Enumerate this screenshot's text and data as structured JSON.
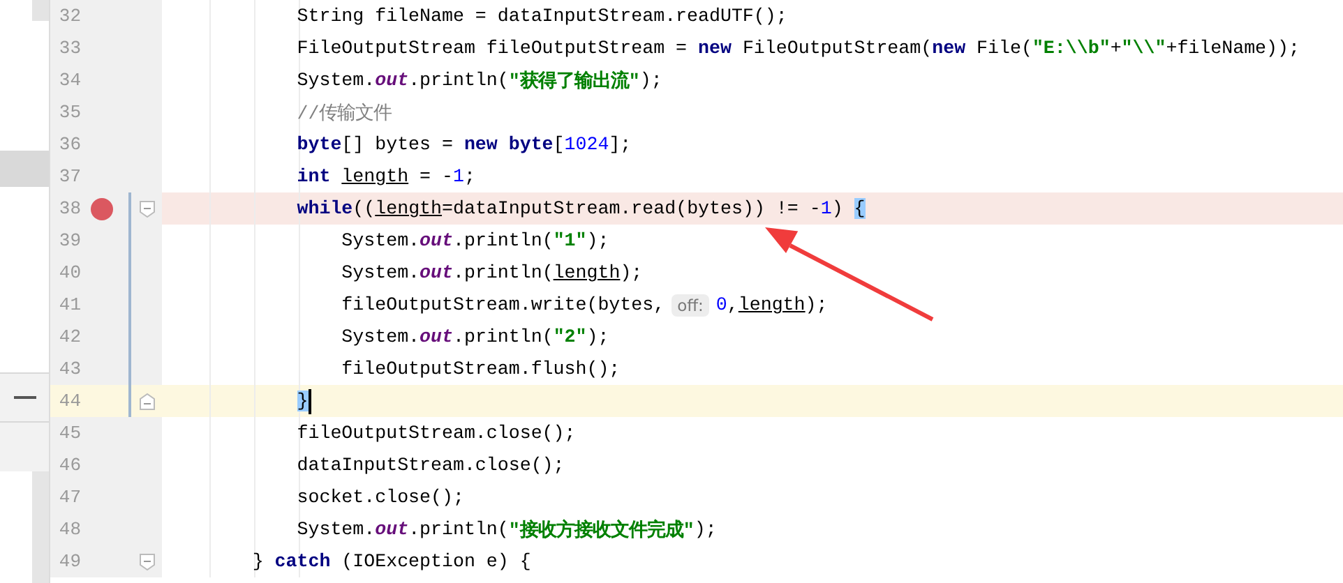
{
  "editor": {
    "lines": [
      {
        "number": "32",
        "breakpoint": false,
        "current": false,
        "fold_start": false,
        "fold_end": false,
        "scope": false,
        "tokens": [
          {
            "kind": "plain",
            "text": "            String fileName = dataInputStream.readUTF();"
          }
        ]
      },
      {
        "number": "33",
        "breakpoint": false,
        "current": false,
        "fold_start": false,
        "fold_end": false,
        "scope": false,
        "tokens": [
          {
            "kind": "plain",
            "text": "            FileOutputStream fileOutputStream = "
          },
          {
            "kind": "keyword",
            "text": "new"
          },
          {
            "kind": "plain",
            "text": " FileOutputStream("
          },
          {
            "kind": "keyword",
            "text": "new"
          },
          {
            "kind": "plain",
            "text": " File("
          },
          {
            "kind": "string",
            "text": "\"E:\\\\b\""
          },
          {
            "kind": "plain",
            "text": "+"
          },
          {
            "kind": "string",
            "text": "\"\\\\\""
          },
          {
            "kind": "plain",
            "text": "+fileName));"
          }
        ]
      },
      {
        "number": "34",
        "breakpoint": false,
        "current": false,
        "fold_start": false,
        "fold_end": false,
        "scope": false,
        "tokens": [
          {
            "kind": "plain",
            "text": "            System."
          },
          {
            "kind": "static",
            "text": "out"
          },
          {
            "kind": "plain",
            "text": ".println("
          },
          {
            "kind": "string",
            "text": "\"获得了输出流\""
          },
          {
            "kind": "plain",
            "text": ");"
          }
        ]
      },
      {
        "number": "35",
        "breakpoint": false,
        "current": false,
        "fold_start": false,
        "fold_end": false,
        "scope": false,
        "tokens": [
          {
            "kind": "comment",
            "text": "            //传输文件"
          }
        ]
      },
      {
        "number": "36",
        "breakpoint": false,
        "current": false,
        "fold_start": false,
        "fold_end": false,
        "scope": false,
        "tokens": [
          {
            "kind": "keyword",
            "text": "            byte"
          },
          {
            "kind": "plain",
            "text": "[] bytes = "
          },
          {
            "kind": "keyword",
            "text": "new byte"
          },
          {
            "kind": "plain",
            "text": "["
          },
          {
            "kind": "number",
            "text": "1024"
          },
          {
            "kind": "plain",
            "text": "];"
          }
        ]
      },
      {
        "number": "37",
        "breakpoint": false,
        "current": false,
        "fold_start": false,
        "fold_end": false,
        "scope": false,
        "tokens": [
          {
            "kind": "keyword",
            "text": "            int "
          },
          {
            "kind": "variable",
            "text": "length"
          },
          {
            "kind": "plain",
            "text": " = -"
          },
          {
            "kind": "number",
            "text": "1"
          },
          {
            "kind": "plain",
            "text": ";"
          }
        ]
      },
      {
        "number": "38",
        "breakpoint": true,
        "current": false,
        "fold_start": true,
        "fold_end": false,
        "scope": true,
        "tokens": [
          {
            "kind": "keyword",
            "text": "            while"
          },
          {
            "kind": "plain",
            "text": "(("
          },
          {
            "kind": "variable",
            "text": "length"
          },
          {
            "kind": "plain",
            "text": "=dataInputStream.read(bytes)) != -"
          },
          {
            "kind": "number",
            "text": "1"
          },
          {
            "kind": "plain",
            "text": ") "
          },
          {
            "kind": "brace_match",
            "text": "{"
          }
        ]
      },
      {
        "number": "39",
        "breakpoint": false,
        "current": false,
        "fold_start": false,
        "fold_end": false,
        "scope": true,
        "tokens": [
          {
            "kind": "plain",
            "text": "                System."
          },
          {
            "kind": "static",
            "text": "out"
          },
          {
            "kind": "plain",
            "text": ".println("
          },
          {
            "kind": "string",
            "text": "\"1\""
          },
          {
            "kind": "plain",
            "text": ");"
          }
        ]
      },
      {
        "number": "40",
        "breakpoint": false,
        "current": false,
        "fold_start": false,
        "fold_end": false,
        "scope": true,
        "tokens": [
          {
            "kind": "plain",
            "text": "                System."
          },
          {
            "kind": "static",
            "text": "out"
          },
          {
            "kind": "plain",
            "text": ".println("
          },
          {
            "kind": "variable",
            "text": "length"
          },
          {
            "kind": "plain",
            "text": ");"
          }
        ]
      },
      {
        "number": "41",
        "breakpoint": false,
        "current": false,
        "fold_start": false,
        "fold_end": false,
        "scope": true,
        "tokens": [
          {
            "kind": "plain",
            "text": "                fileOutputStream.write(bytes,"
          },
          {
            "kind": "hint",
            "text": "off:"
          },
          {
            "kind": "number",
            "text": "0"
          },
          {
            "kind": "plain",
            "text": ","
          },
          {
            "kind": "variable",
            "text": "length"
          },
          {
            "kind": "plain",
            "text": ");"
          }
        ]
      },
      {
        "number": "42",
        "breakpoint": false,
        "current": false,
        "fold_start": false,
        "fold_end": false,
        "scope": true,
        "tokens": [
          {
            "kind": "plain",
            "text": "                System."
          },
          {
            "kind": "static",
            "text": "out"
          },
          {
            "kind": "plain",
            "text": ".println("
          },
          {
            "kind": "string",
            "text": "\"2\""
          },
          {
            "kind": "plain",
            "text": ");"
          }
        ]
      },
      {
        "number": "43",
        "breakpoint": false,
        "current": false,
        "fold_start": false,
        "fold_end": false,
        "scope": true,
        "tokens": [
          {
            "kind": "plain",
            "text": "                fileOutputStream.flush();"
          }
        ]
      },
      {
        "number": "44",
        "breakpoint": false,
        "current": true,
        "fold_start": false,
        "fold_end": true,
        "scope": true,
        "tokens": [
          {
            "kind": "brace_match",
            "text": "            }"
          }
        ]
      },
      {
        "number": "45",
        "breakpoint": false,
        "current": false,
        "fold_start": false,
        "fold_end": false,
        "scope": false,
        "tokens": [
          {
            "kind": "plain",
            "text": "            fileOutputStream.close();"
          }
        ]
      },
      {
        "number": "46",
        "breakpoint": false,
        "current": false,
        "fold_start": false,
        "fold_end": false,
        "scope": false,
        "tokens": [
          {
            "kind": "plain",
            "text": "            dataInputStream.close();"
          }
        ]
      },
      {
        "number": "47",
        "breakpoint": false,
        "current": false,
        "fold_start": false,
        "fold_end": false,
        "scope": false,
        "tokens": [
          {
            "kind": "plain",
            "text": "            socket.close();"
          }
        ]
      },
      {
        "number": "48",
        "breakpoint": false,
        "current": false,
        "fold_start": false,
        "fold_end": false,
        "scope": false,
        "tokens": [
          {
            "kind": "plain",
            "text": "            System."
          },
          {
            "kind": "static",
            "text": "out"
          },
          {
            "kind": "plain",
            "text": ".println("
          },
          {
            "kind": "string",
            "text": "\"接收方接收文件完成\""
          },
          {
            "kind": "plain",
            "text": ");"
          }
        ]
      },
      {
        "number": "49",
        "breakpoint": false,
        "current": false,
        "fold_start": true,
        "fold_end": false,
        "scope": false,
        "tokens": [
          {
            "kind": "plain",
            "text": "        } "
          },
          {
            "kind": "keyword",
            "text": "catch"
          },
          {
            "kind": "plain",
            "text": " (IOException e) {"
          }
        ]
      }
    ]
  }
}
